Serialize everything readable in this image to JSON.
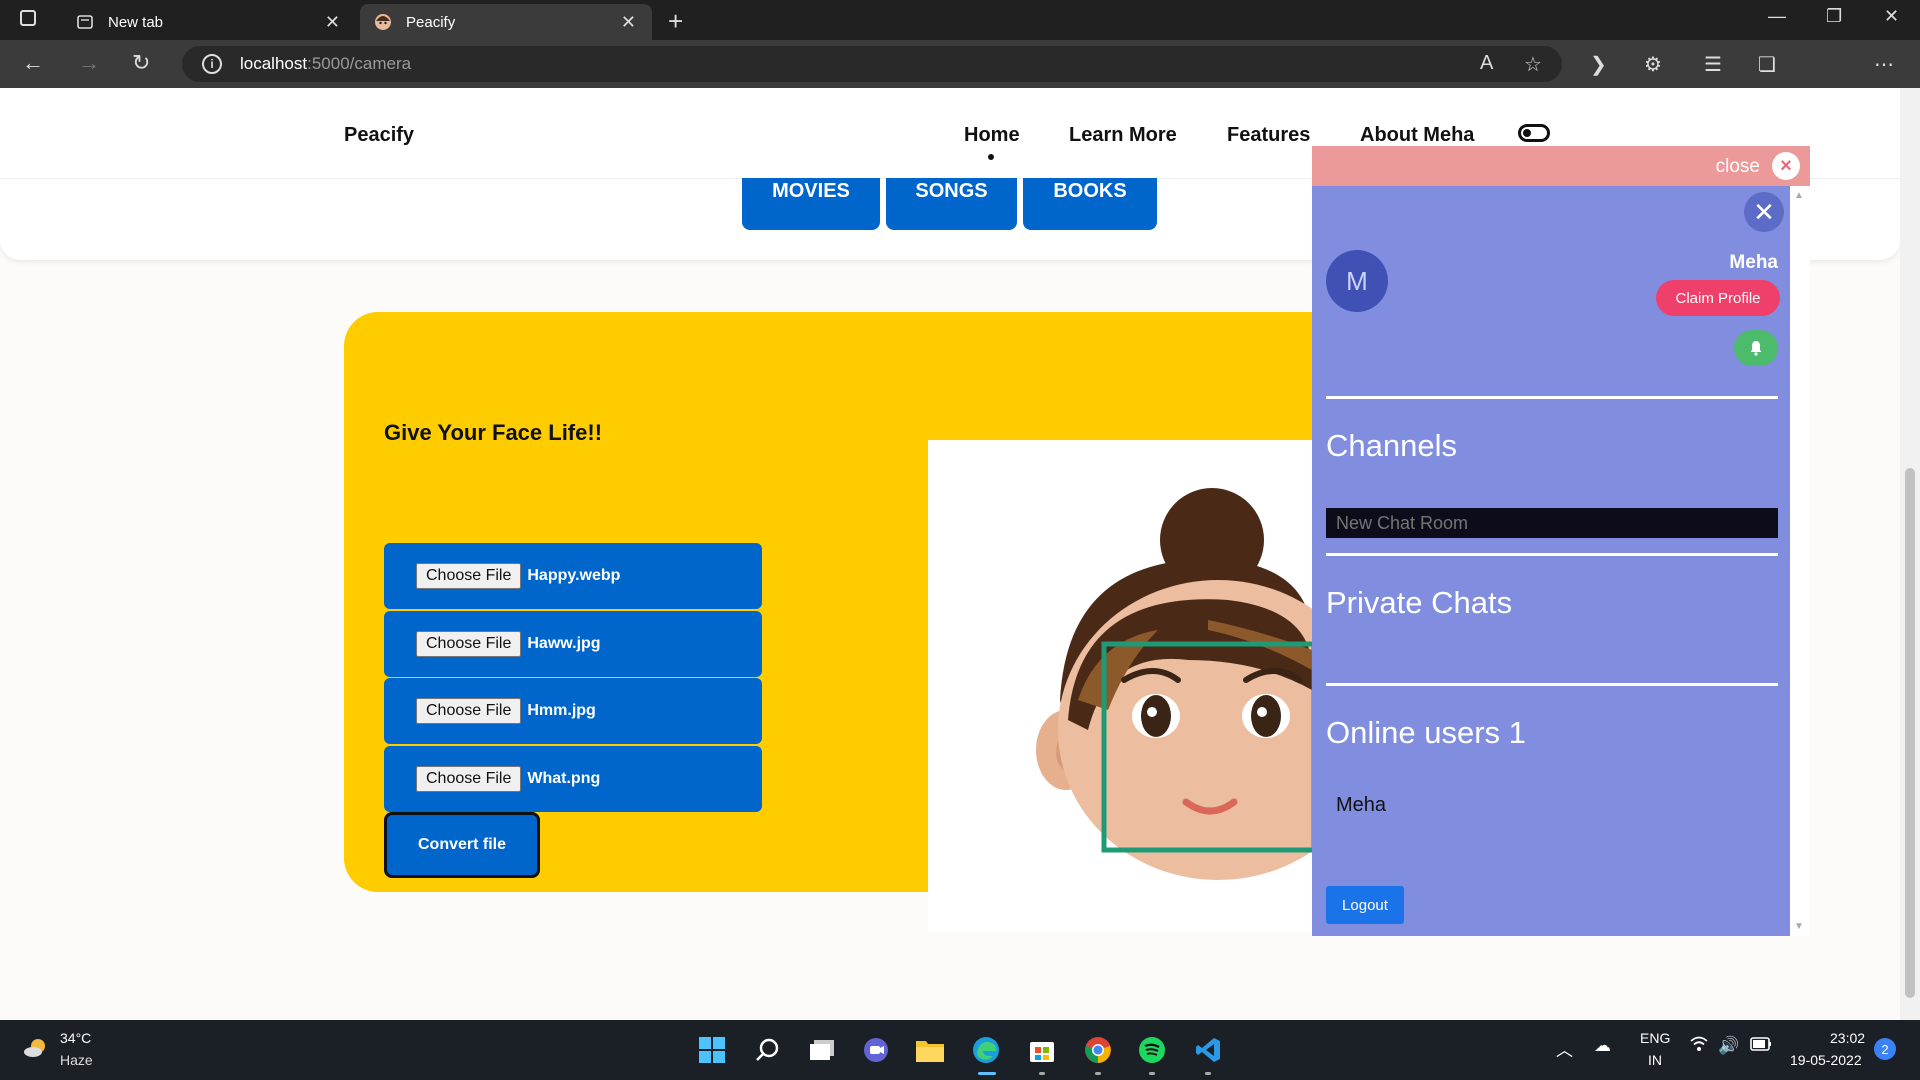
{
  "browser": {
    "tabs": [
      {
        "title": "New tab",
        "active": false
      },
      {
        "title": "Peacify",
        "active": true
      }
    ],
    "url_host": "localhost",
    "url_path": ":5000/camera"
  },
  "nav": {
    "brand": "Peacify",
    "links": [
      "Home",
      "Learn More",
      "Features",
      "About Meha"
    ]
  },
  "categories": [
    "MOVIES",
    "SONGS",
    "BOOKS"
  ],
  "converter": {
    "title": "Give Your Face Life!!",
    "choose_label": "Choose File",
    "files": [
      "Happy.webp",
      "Haww.jpg",
      "Hmm.jpg",
      "What.png"
    ],
    "convert_label": "Convert file"
  },
  "chat": {
    "close_label": "close",
    "avatar_letter": "M",
    "username": "Meha",
    "claim_label": "Claim Profile",
    "channels_heading": "Channels",
    "new_room_placeholder": "New Chat Room",
    "private_heading": "Private Chats",
    "online_heading": "Online users 1",
    "online_users": [
      "Meha"
    ],
    "logout_label": "Logout"
  },
  "taskbar": {
    "temperature": "34°C",
    "condition": "Haze",
    "lang_top": "ENG",
    "lang_bottom": "IN",
    "time": "23:02",
    "date": "19-05-2022",
    "notification_count": "2"
  },
  "colors": {
    "accent_blue": "#0066cc",
    "panel_yellow": "#ffcc00",
    "chat_panel": "#818ee0",
    "claim_pink": "#ef3f6b"
  }
}
